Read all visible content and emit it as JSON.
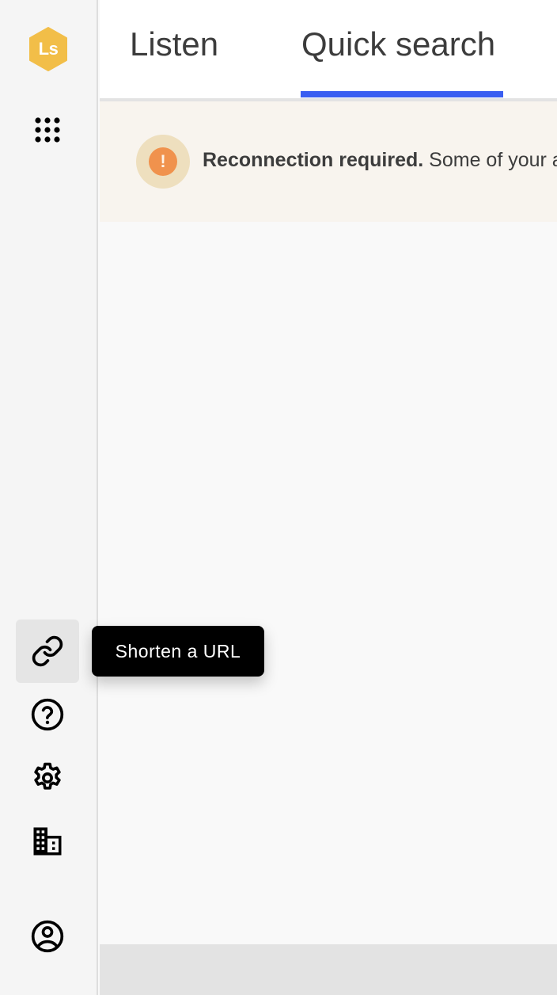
{
  "sidebar": {
    "logo": {
      "text": "Ls",
      "color": "#f2be48"
    },
    "items": [
      {
        "name": "apps",
        "icon": "grid-dots-icon"
      },
      {
        "name": "shorten-url",
        "icon": "link-icon",
        "active": true
      },
      {
        "name": "help",
        "icon": "help-circle-icon"
      },
      {
        "name": "settings",
        "icon": "gear-icon"
      },
      {
        "name": "organization",
        "icon": "building-icon"
      },
      {
        "name": "account",
        "icon": "user-circle-icon"
      }
    ]
  },
  "tabs": [
    {
      "label": "Listen",
      "active": false
    },
    {
      "label": "Quick search",
      "active": true
    }
  ],
  "accent_color": "#3a5ef1",
  "banner": {
    "icon": "exclamation-icon",
    "title": "Reconnection required.",
    "message": " Some of your a"
  },
  "tooltip": {
    "text": "Shorten a URL"
  }
}
